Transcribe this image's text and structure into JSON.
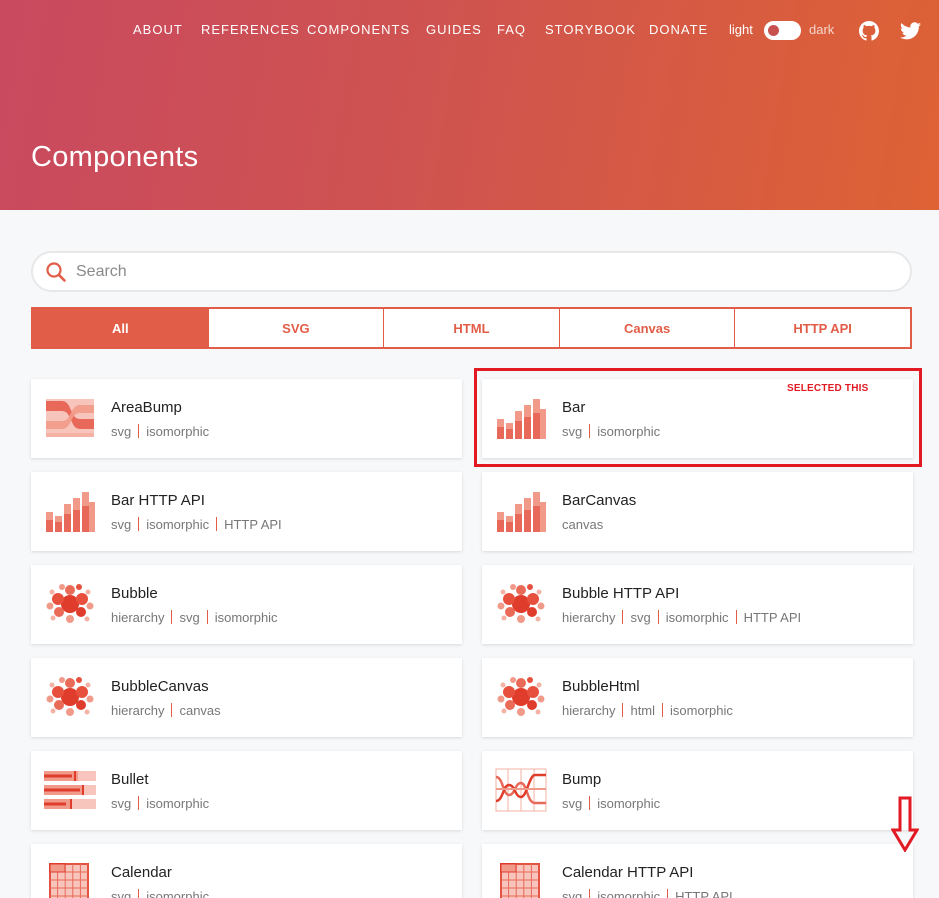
{
  "nav": {
    "items": [
      "ABOUT",
      "REFERENCES",
      "COMPONENTS",
      "GUIDES",
      "FAQ",
      "STORYBOOK",
      "DONATE"
    ],
    "theme_light": "light",
    "theme_dark": "dark"
  },
  "icons": {
    "github": "github-icon",
    "twitter": "twitter-icon",
    "search": "search-icon"
  },
  "page": {
    "title": "Components"
  },
  "search": {
    "placeholder": "Search",
    "value": ""
  },
  "tabs": [
    "All",
    "SVG",
    "HTML",
    "Canvas",
    "HTTP API"
  ],
  "active_tab": "All",
  "colors": {
    "accent": "#e25d47",
    "annotation": "#e11a23",
    "gradient_start": "#c9495f",
    "gradient_end": "#de6234"
  },
  "cards": [
    {
      "name": "AreaBump",
      "tags": [
        "svg",
        "isomorphic"
      ],
      "icon": "areabump-icon"
    },
    {
      "name": "Bar",
      "tags": [
        "svg",
        "isomorphic"
      ],
      "icon": "bar-chart-icon"
    },
    {
      "name": "Bar HTTP API",
      "tags": [
        "svg",
        "isomorphic",
        "HTTP API"
      ],
      "icon": "bar-chart-icon"
    },
    {
      "name": "BarCanvas",
      "tags": [
        "canvas"
      ],
      "icon": "bar-chart-icon"
    },
    {
      "name": "Bubble",
      "tags": [
        "hierarchy",
        "svg",
        "isomorphic"
      ],
      "icon": "bubble-icon"
    },
    {
      "name": "Bubble HTTP API",
      "tags": [
        "hierarchy",
        "svg",
        "isomorphic",
        "HTTP API"
      ],
      "icon": "bubble-icon"
    },
    {
      "name": "BubbleCanvas",
      "tags": [
        "hierarchy",
        "canvas"
      ],
      "icon": "bubble-icon"
    },
    {
      "name": "BubbleHtml",
      "tags": [
        "hierarchy",
        "html",
        "isomorphic"
      ],
      "icon": "bubble-icon"
    },
    {
      "name": "Bullet",
      "tags": [
        "svg",
        "isomorphic"
      ],
      "icon": "bullet-icon"
    },
    {
      "name": "Bump",
      "tags": [
        "svg",
        "isomorphic"
      ],
      "icon": "bump-icon"
    },
    {
      "name": "Calendar",
      "tags": [
        "svg",
        "isomorphic"
      ],
      "icon": "calendar-icon"
    },
    {
      "name": "Calendar HTTP API",
      "tags": [
        "svg",
        "isomorphic",
        "HTTP API"
      ],
      "icon": "calendar-icon"
    }
  ],
  "annotation": {
    "label": "SELECTED THIS",
    "arrow_icon": "down-arrow-icon"
  }
}
